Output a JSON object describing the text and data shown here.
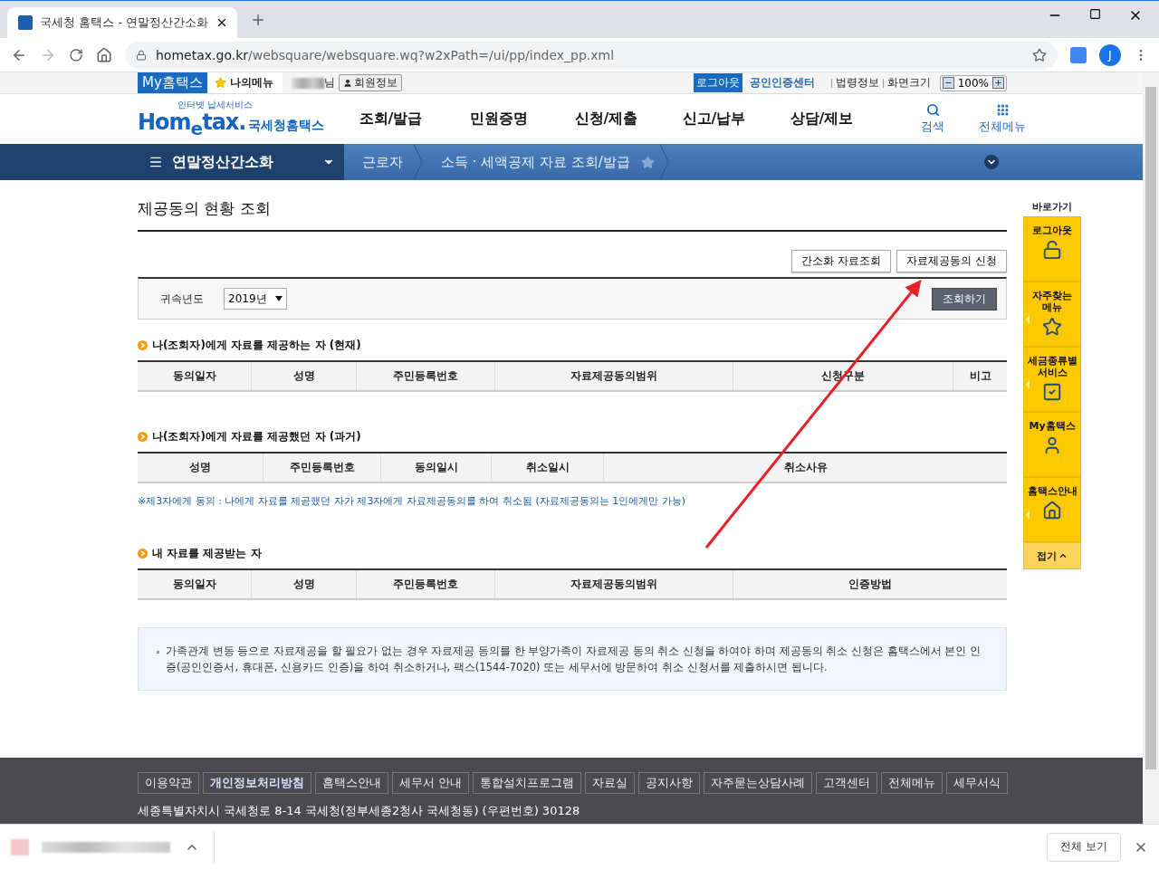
{
  "browser": {
    "tab_title": "국세청 홈택스 - 연말정산간소화",
    "url_host": "hometax.go.kr",
    "url_path": "/websquare/websquare.wq?w2xPath=/ui/pp/index_pp.xml",
    "profile": "J"
  },
  "utility_bar": {
    "my_hometax": "My홈택스",
    "my_menu": "나의메뉴",
    "name_suffix": "님",
    "member_info": "회원정보",
    "logout": "로그아웃",
    "cert_center": "공인인증센터",
    "law_info": "법령정보",
    "screen_size": "화면크기",
    "zoom": "100%"
  },
  "header": {
    "logo_tagline": "인터넷 납세서비스",
    "logo_word": "Hom$_{e}$tax.",
    "logo_title": "국세청홈택스",
    "nav": [
      "조회/발급",
      "민원증명",
      "신청/제출",
      "신고/납부",
      "상담/제보"
    ],
    "search": "검색",
    "all_menu": "전체메뉴"
  },
  "breadcrumb": {
    "menu": "연말정산간소화",
    "items": [
      "근로자",
      "소득 · 세액공제 자료 조회/발급"
    ],
    "favorite": false
  },
  "page": {
    "title": "제공동의 현황 조회",
    "buttons": [
      "간소화 자료조회",
      "자료제공동의 신청"
    ],
    "filter": {
      "label": "귀속년도",
      "year": "2019년",
      "submit": "조회하기"
    },
    "sections": [
      {
        "title": "나(조회자)에게 자료를 제공하는 자 (현재)",
        "columns": [
          "동의일자",
          "성명",
          "주민등록번호",
          "자료제공동의범위",
          "신청구분",
          "비고"
        ]
      },
      {
        "title": "나(조회자)에게 자료를 제공했던 자 (과거)",
        "columns": [
          "성명",
          "주민등록번호",
          "동의일시",
          "취소일시",
          "취소사유"
        ],
        "note": "※제3자에게 동의 : 나에게 자료를 제공했던 자가 제3자에게 자료제공동의를 하여 취소됨 (자료제공동의는 1인에게만 가능)"
      },
      {
        "title": "내 자료를 제공받는 자",
        "columns": [
          "동의일자",
          "성명",
          "주민등록번호",
          "자료제공동의범위",
          "인증방법"
        ]
      }
    ],
    "notice": "가족관계 변동 등으로 자료제공을 할 필요가 없는 경우 자료제공 동의를 한 부양가족이 자료제공 동의 취소 신청을 하여야 하며 제공동의 취소 신청은 홈택스에서 본인 인증(공인인증서, 휴대폰, 신용카드 인증)을 하여 취소하거나, 팩스(1544-7020) 또는 세무서에 방문하여 취소 신청서를 제출하시면 됩니다."
  },
  "quick_menu": {
    "title": "바로가기",
    "items": [
      {
        "label": "로그아웃",
        "kind": "logout"
      },
      {
        "label": "자주찾는 메뉴",
        "kind": "favorites"
      },
      {
        "label": "세금종류별 서비스",
        "kind": "tax"
      },
      {
        "label": "My홈택스",
        "kind": "my"
      },
      {
        "label": "홈택스안내",
        "kind": "guide"
      }
    ],
    "fold": "접기"
  },
  "footer": {
    "links": [
      {
        "label": "이용약관",
        "selected": false
      },
      {
        "label": "개인정보처리방침",
        "selected": true
      },
      {
        "label": "홈택스안내",
        "selected": false
      },
      {
        "label": "세무서 안내",
        "selected": false
      },
      {
        "label": "통합설치프로그램",
        "selected": false
      },
      {
        "label": "자료실",
        "selected": false
      },
      {
        "label": "공지사항",
        "selected": false
      },
      {
        "label": "자주묻는상담사례",
        "selected": false
      },
      {
        "label": "고객센터",
        "selected": false
      },
      {
        "label": "전체메뉴",
        "selected": false
      },
      {
        "label": "세무서식",
        "selected": false
      }
    ],
    "address": "세종특별자치시 국세청로 8-14 국세청(정부세종2청사 국세청동) (우편번호) 30128"
  },
  "download_bar": {
    "show_all": "전체 보기"
  }
}
